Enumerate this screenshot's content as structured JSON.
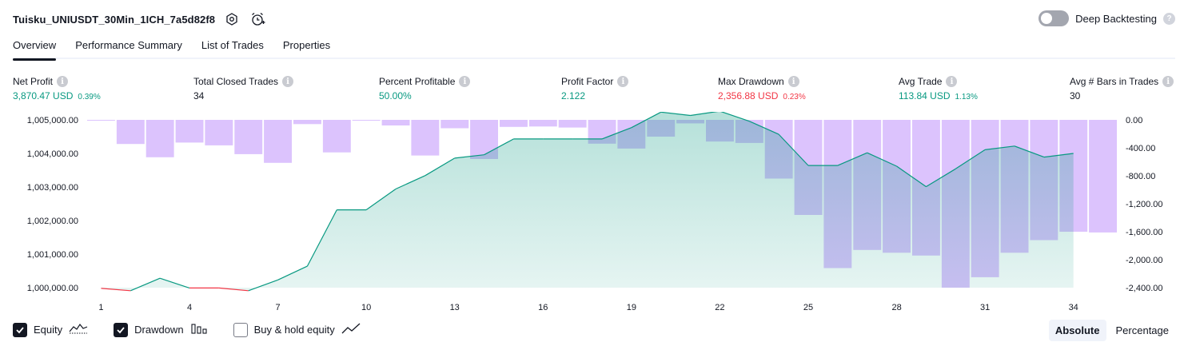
{
  "header": {
    "title": "Tuisku_UNIUSDT_30Min_1ICH_7a5d82f8",
    "deep_backtesting_label": "Deep Backtesting",
    "deep_backtesting_enabled": false
  },
  "tabs": [
    {
      "label": "Overview",
      "active": true
    },
    {
      "label": "Performance Summary",
      "active": false
    },
    {
      "label": "List of Trades",
      "active": false
    },
    {
      "label": "Properties",
      "active": false
    }
  ],
  "metrics": {
    "net_profit": {
      "label": "Net Profit",
      "value": "3,870.47 USD",
      "pct": "0.39%"
    },
    "total_closed_trades": {
      "label": "Total Closed Trades",
      "value": "34"
    },
    "percent_profitable": {
      "label": "Percent Profitable",
      "value": "50.00%"
    },
    "profit_factor": {
      "label": "Profit Factor",
      "value": "2.122"
    },
    "max_drawdown": {
      "label": "Max Drawdown",
      "value": "2,356.88 USD",
      "pct": "0.23%"
    },
    "avg_trade": {
      "label": "Avg Trade",
      "value": "113.84 USD",
      "pct": "1.13%"
    },
    "avg_bars": {
      "label": "Avg # Bars in Trades",
      "value": "30"
    }
  },
  "chart_data": {
    "type": "area",
    "x": [
      1,
      2,
      3,
      4,
      5,
      6,
      7,
      8,
      9,
      10,
      11,
      12,
      13,
      14,
      15,
      16,
      17,
      18,
      19,
      20,
      21,
      22,
      23,
      24,
      25,
      26,
      27,
      28,
      29,
      30,
      31,
      32,
      33,
      34,
      35
    ],
    "x_ticks": [
      "1",
      "4",
      "7",
      "10",
      "13",
      "16",
      "19",
      "22",
      "25",
      "28",
      "31",
      "34"
    ],
    "left_axis": {
      "ticks": [
        "1,005,000.00",
        "1,004,000.00",
        "1,003,000.00",
        "1,002,000.00",
        "1,001,000.00",
        "1,000,000.00"
      ],
      "tick_values": [
        1005000,
        1004000,
        1003000,
        1002000,
        1001000,
        1000000
      ]
    },
    "right_axis": {
      "ticks": [
        "0.00",
        "-400.00",
        "-800.00",
        "-1,200.00",
        "-1,600.00",
        "-2,000.00",
        "-2,400.00"
      ],
      "tick_values": [
        0,
        -400,
        -800,
        -1200,
        -1600,
        -2000,
        -2400
      ]
    },
    "series": [
      {
        "name": "Equity",
        "values": [
          999980,
          999910,
          1000280,
          999990,
          999990,
          999910,
          1000230,
          1000640,
          1002320,
          1002320,
          1002940,
          1003340,
          1003860,
          1003960,
          1004430,
          1004430,
          1004430,
          1004430,
          1004770,
          1005230,
          1005130,
          1005260,
          1004960,
          1004570,
          1003640,
          1003640,
          1004020,
          1003620,
          1003010,
          1003540,
          1004110,
          1004220,
          1003890,
          1004000
        ],
        "color_up": "#089981",
        "color_down": "#f23645",
        "fill": "#089981"
      },
      {
        "name": "Drawdown",
        "values": [
          0,
          -345,
          -535,
          -325,
          -365,
          -490,
          -615,
          -60,
          -465,
          0,
          -80,
          -510,
          -120,
          -560,
          -100,
          -95,
          -110,
          -340,
          -410,
          -240,
          -50,
          -310,
          -330,
          -840,
          -1360,
          -2120,
          -1860,
          -1900,
          -1940,
          -2400,
          -2250,
          -1900,
          -1720,
          -1600,
          -1610
        ],
        "color": "#c79efc"
      }
    ],
    "legend": [
      {
        "label": "Equity",
        "checked": true,
        "icon": "equity-line-icon"
      },
      {
        "label": "Drawdown",
        "checked": true,
        "icon": "drawdown-bars-icon"
      },
      {
        "label": "Buy & hold equity",
        "checked": false,
        "icon": "buy-hold-line-icon"
      }
    ]
  },
  "view_modes": [
    {
      "label": "Absolute",
      "active": true
    },
    {
      "label": "Percentage",
      "active": false
    }
  ],
  "colors": {
    "positive": "#089981",
    "negative": "#f23645",
    "drawdown": "#c79efc",
    "text": "#131722"
  }
}
